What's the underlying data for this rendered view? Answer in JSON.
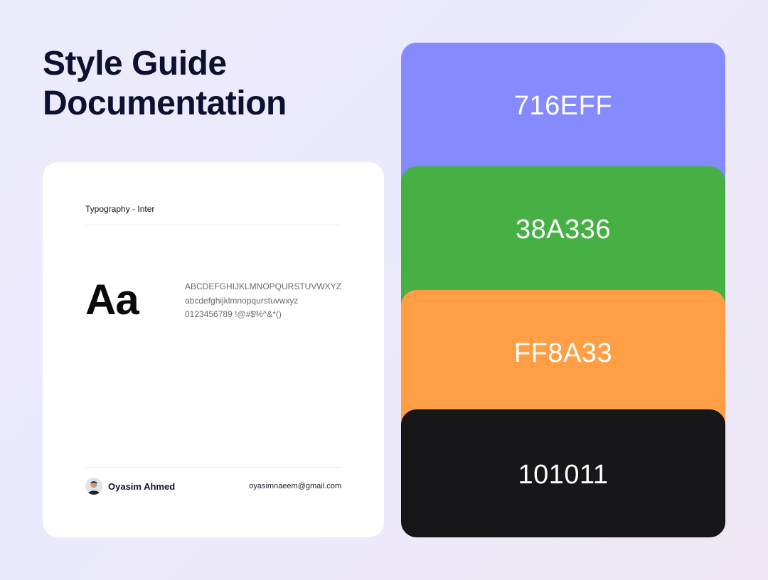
{
  "page": {
    "title_line1": "Style Guide",
    "title_line2": "Documentation"
  },
  "typography_card": {
    "heading": "Typography - Inter",
    "specimen": "Aa",
    "uppercase": "ABCDEFGHIJKLMNOPQURSTUVWXYZ",
    "lowercase": "abcdefghijklmnopqurstuvwxyz",
    "numbers_symbols": "0123456789 !@#$%^&*()"
  },
  "author": {
    "name": "Oyasim Ahmed",
    "email": "oyasimnaeem@gmail.com",
    "avatar_icon": "user-avatar"
  },
  "swatches": [
    {
      "label": "716EFF",
      "color": "#858aff"
    },
    {
      "label": "38A336",
      "color": "#46b045"
    },
    {
      "label": "FF8A33",
      "color": "#ff9e44"
    },
    {
      "label": "101011",
      "color": "#17171a"
    }
  ]
}
